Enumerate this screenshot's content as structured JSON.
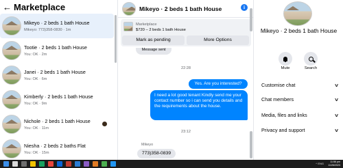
{
  "left": {
    "back_glyph": "←",
    "title": "Marketplace",
    "conversations": [
      {
        "name": "Mikeyo · 2 beds 1 bath House",
        "sub": "Mikeyo: 773)358-0830 · 1m"
      },
      {
        "name": "Tootie · 2 beds 1 bath House",
        "sub": "You: OK · 2m"
      },
      {
        "name": "Janei · 2 beds 1 bath House",
        "sub": "You: OK · 6m"
      },
      {
        "name": "Kimberly · 2 beds 1 bath House",
        "sub": "You: OK · 9m"
      },
      {
        "name": "Nichole · 2 beds 1 bath House",
        "sub": "You: OK · 11m"
      },
      {
        "name": "Niesha · 2 beds 2 baths Flat",
        "sub": "You: OK · 15m"
      }
    ]
  },
  "chat": {
    "title": "Mikeyo · 2 beds 1 bath House",
    "info_glyph": "i",
    "listing": {
      "label": "Marketplace",
      "detail": "$720 – 2 beds 1 bath House",
      "mark_pending": "Mark as pending",
      "more_options": "More Options"
    },
    "partial_message": "Message sent",
    "time1": "22:28",
    "msg_interested": "Yes. Are you interested?",
    "msg_long": "I need a lot good tenant Kindly send me your contact number so i can send you details and the requirements about the house.",
    "time2": "23:12",
    "sender": "Mikeyo",
    "msg_reply": "773)358-0839"
  },
  "right": {
    "name": "Mikeyo · 2 beds 1 bath House",
    "mute_label": "Mute",
    "search_label": "Search",
    "sections": [
      "Customise chat",
      "Chat members",
      "Media, files and links",
      "Privacy and support"
    ],
    "chevron_glyph": "∨"
  },
  "taskbar": {
    "clock_time": "11:56 pm",
    "clock_date": "11/26/2023",
    "tray_text": "^ ENG"
  },
  "colors": {
    "accent": "#1877f2",
    "my_bubble": "#0084ff",
    "selected_row": "#e7f0fb",
    "secondary_text": "#65676b"
  }
}
